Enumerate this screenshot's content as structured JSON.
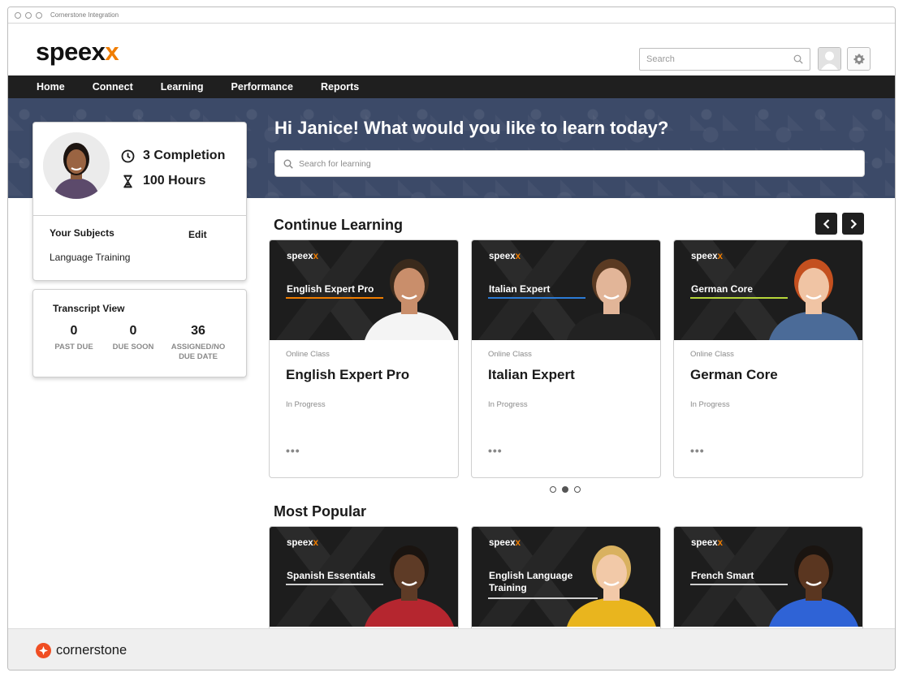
{
  "window": {
    "title": "Cornerstone Integration"
  },
  "header": {
    "logo_text": "speex",
    "logo_accent": "x",
    "search_placeholder": "Search"
  },
  "nav": {
    "items": [
      "Home",
      "Connect",
      "Learning",
      "Performance",
      "Reports"
    ]
  },
  "hero": {
    "greeting": "Hi Janice! What would you like to learn today?",
    "search_placeholder": "Search for learning"
  },
  "profile": {
    "completion": "3 Completion",
    "hours": "100 Hours",
    "subjects_title": "Your Subjects",
    "edit_label": "Edit",
    "subjects": [
      "Language Training"
    ]
  },
  "transcript": {
    "title": "Transcript View",
    "columns": [
      {
        "value": "0",
        "label": "PAST DUE"
      },
      {
        "value": "0",
        "label": "DUE SOON"
      },
      {
        "value": "36",
        "label": "ASSIGNED/NO DUE DATE"
      }
    ]
  },
  "continue_learning": {
    "title": "Continue Learning",
    "cards": [
      {
        "brand": "speex",
        "brand_accent": "x",
        "thumb_title": "English Expert Pro",
        "type": "Online Class",
        "name": "English Expert Pro",
        "status": "In Progress",
        "more": "•••",
        "accent": "#f07d00"
      },
      {
        "brand": "speex",
        "brand_accent": "x",
        "thumb_title": "Italian Expert",
        "type": "Online Class",
        "name": "Italian Expert",
        "status": "In Progress",
        "more": "•••",
        "accent": "#2b7bd6"
      },
      {
        "brand": "speex",
        "brand_accent": "x",
        "thumb_title": "German Core",
        "type": "Online Class",
        "name": "German Core",
        "status": "In Progress",
        "more": "•••",
        "accent": "#b6d63a"
      }
    ],
    "pager_active": 2,
    "pager_count": 3
  },
  "most_popular": {
    "title": "Most Popular",
    "cards": [
      {
        "brand": "speex",
        "brand_accent": "x",
        "thumb_title": "Spanish Essentials",
        "accent": "#cfcfcf"
      },
      {
        "brand": "speex",
        "brand_accent": "x",
        "thumb_title": "English Language Training",
        "accent": "#cfcfcf"
      },
      {
        "brand": "speex",
        "brand_accent": "x",
        "thumb_title": "French Smart",
        "accent": "#cfcfcf"
      }
    ]
  },
  "footer": {
    "brand": "cornerstone",
    "brand_color": "#f04e23"
  },
  "colors": {
    "accent": "#f07d00",
    "nav_bg": "#1f1f1f",
    "hero_bg": "#3c4a68"
  }
}
